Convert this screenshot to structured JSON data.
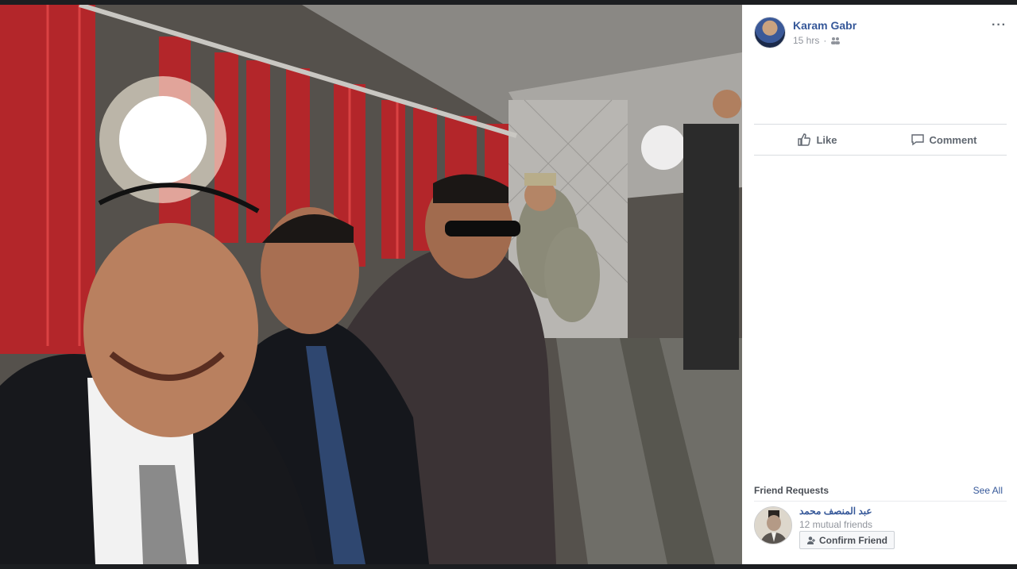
{
  "post": {
    "author": "Karam Gabr",
    "time": "15 hrs",
    "audience_icon": "friends-icon",
    "more_label": "···"
  },
  "actions": {
    "like_label": "Like",
    "comment_label": "Comment"
  },
  "friend_requests": {
    "title": "Friend Requests",
    "see_all": "See All",
    "items": [
      {
        "name": "عبد المنصف محمد",
        "mutual": "12 mutual friends",
        "confirm_label": "Confirm Friend"
      }
    ]
  },
  "colors": {
    "link": "#365899",
    "muted": "#90949c",
    "panel_bg": "#ffffff"
  }
}
